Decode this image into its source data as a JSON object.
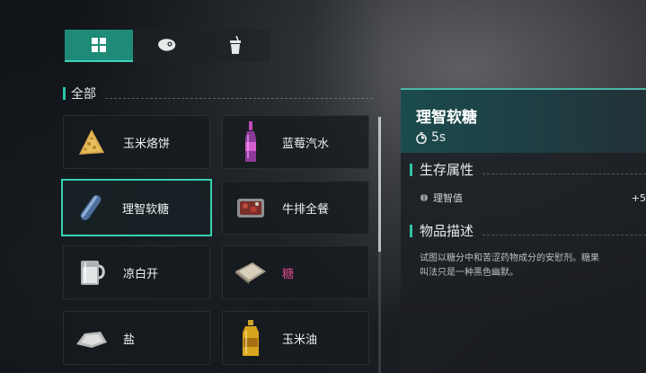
{
  "tabs": [
    {
      "icon": "grid-icon",
      "active": true
    },
    {
      "icon": "meat-icon",
      "active": false
    },
    {
      "icon": "drink-cup-icon",
      "active": false
    }
  ],
  "category": {
    "label": "全部"
  },
  "items": [
    {
      "name": "玉米烙饼",
      "icon": "corn-pancake-icon",
      "selected": false
    },
    {
      "name": "蓝莓汽水",
      "icon": "blueberry-soda-icon",
      "selected": false
    },
    {
      "name": "理智软糖",
      "icon": "sanity-candy-icon",
      "selected": true
    },
    {
      "name": "牛排全餐",
      "icon": "steak-meal-icon",
      "selected": false
    },
    {
      "name": "凉白开",
      "icon": "water-mug-icon",
      "selected": false
    },
    {
      "name": "糖",
      "icon": "sugar-packet-icon",
      "selected": false,
      "color": "#d94a8a"
    },
    {
      "name": "盐",
      "icon": "salt-pile-icon",
      "selected": false
    },
    {
      "name": "玉米油",
      "icon": "corn-oil-icon",
      "selected": false
    }
  ],
  "detail": {
    "title": "理智软糖",
    "timer": "5s",
    "survival_heading": "生存属性",
    "attribute": {
      "name": "理智值",
      "value": "+5"
    },
    "description_heading": "物品描述",
    "description_lines": [
      "试图以糖分中和苦涩药物成分的安慰剂。糖果",
      "叫法只是一种黑色幽默。"
    ]
  },
  "colors": {
    "accent": "#2fc3a6",
    "selected_border": "#38cfb0",
    "tab_active": "#1f8a78",
    "pink_text": "#d94a8a"
  }
}
